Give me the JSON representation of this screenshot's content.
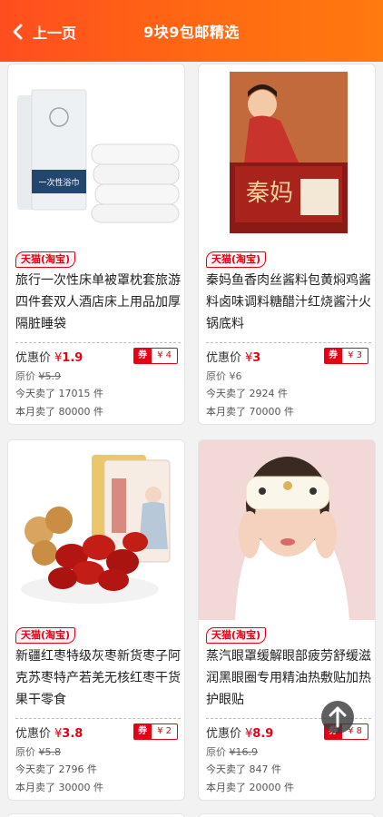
{
  "header": {
    "back_label": "上一页",
    "title": "9块9包邮精选"
  },
  "labels": {
    "price": "优惠价",
    "coupon": "券",
    "orig": "原价",
    "currency": "¥"
  },
  "products": [
    {
      "tag": "天猫(淘宝)",
      "title": "旅行一次性床单被罩枕套旅游四件套双人酒店床上用品加厚隔脏睡袋",
      "price": "1.9",
      "coupon": "¥ 4",
      "orig": "5.9",
      "orig_struck": true,
      "sold_today": "今天卖了 17015 件",
      "sold_month": "本月卖了 80000 件",
      "image_text": "一次性浴巾",
      "image_label": "bedding-pack-image"
    },
    {
      "tag": "天猫(淘宝)",
      "title": "秦妈鱼香肉丝酱料包黄焖鸡酱料卤味调料糖醋汁红烧酱汁火锅底料",
      "price": "3",
      "coupon": "¥ 3",
      "orig": "6",
      "orig_struck": false,
      "sold_today": "今天卖了 2924 件",
      "sold_month": "本月卖了 70000 件",
      "image_text": "秦妈",
      "image_label": "sauce-pack-image"
    },
    {
      "tag": "天猫(淘宝)",
      "title": "新疆红枣特级灰枣新货枣子阿克苏枣特产若羌无核红枣干货果干零食",
      "price": "3.8",
      "coupon": "¥ 2",
      "orig": "5.8",
      "orig_struck": true,
      "sold_today": "今天卖了 2796 件",
      "sold_month": "本月卖了 30000 件",
      "image_text": "",
      "image_label": "red-dates-image"
    },
    {
      "tag": "天猫(淘宝)",
      "title": "蒸汽眼罩缓解眼部疲劳舒缓滋润黑眼圈专用精油热敷贴加热护眼贴",
      "price": "8.9",
      "coupon": "¥ 8",
      "orig": "16.9",
      "orig_struck": true,
      "sold_today": "今天卖了 847 件",
      "sold_month": "本月卖了 20000 件",
      "image_text": "",
      "image_label": "steam-eye-mask-image"
    }
  ]
}
